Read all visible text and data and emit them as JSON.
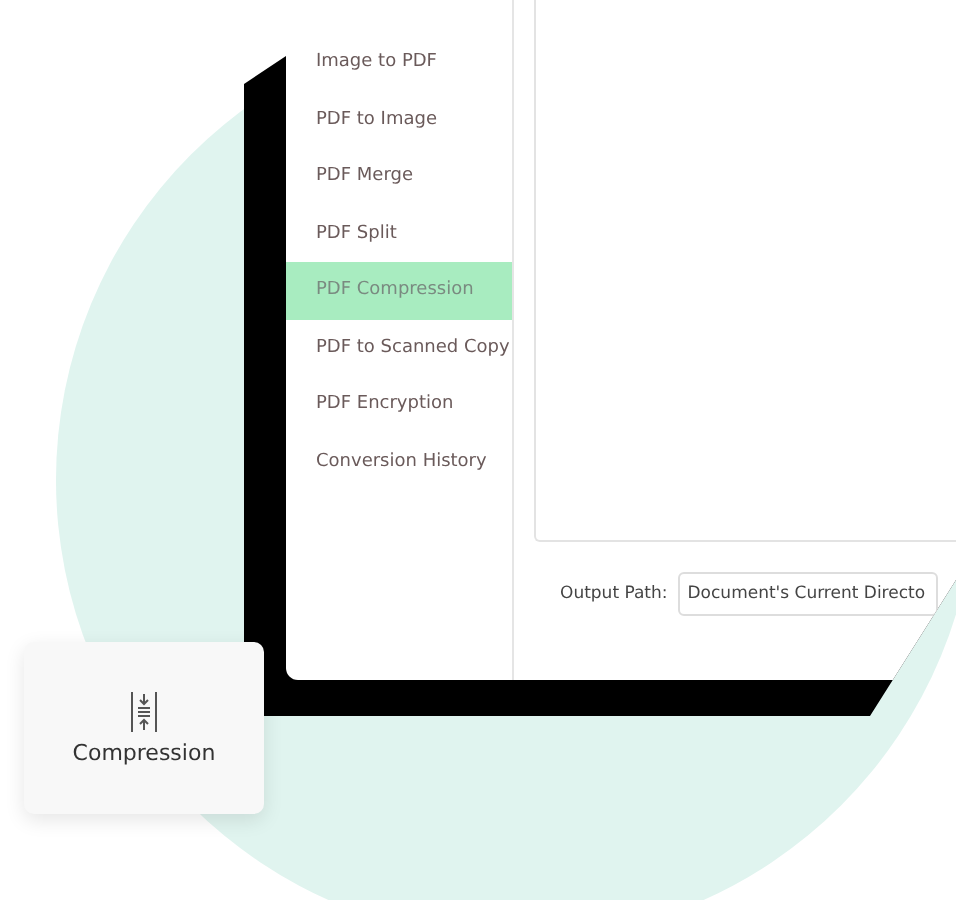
{
  "sidebar": {
    "items": [
      {
        "label": "Image to PDF",
        "selected": false
      },
      {
        "label": "PDF to Image",
        "selected": false
      },
      {
        "label": "PDF Merge",
        "selected": false
      },
      {
        "label": "PDF Split",
        "selected": false
      },
      {
        "label": "PDF Compression",
        "selected": true
      },
      {
        "label": "PDF to Scanned Copy",
        "selected": false
      },
      {
        "label": "PDF Encryption",
        "selected": false
      },
      {
        "label": "Conversion History",
        "selected": false
      }
    ]
  },
  "output_path": {
    "label": "Output Path:",
    "value": "Document's Current Directo"
  },
  "feature_card": {
    "label": "Compression"
  }
}
